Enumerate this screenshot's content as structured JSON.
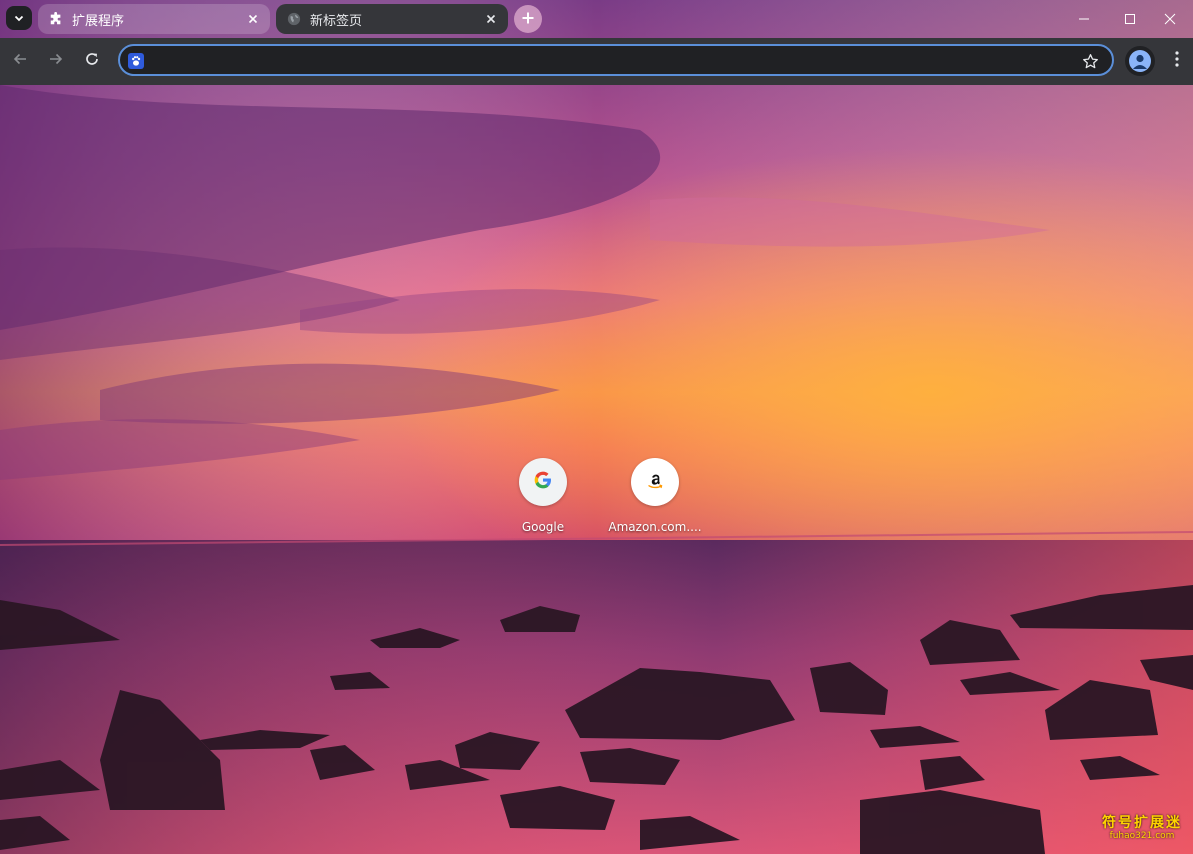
{
  "tabs": [
    {
      "label": "扩展程序",
      "favicon": "puzzle-icon",
      "active": false
    },
    {
      "label": "新标签页",
      "favicon": "globe-icon",
      "active": true
    }
  ],
  "omnibox": {
    "value": "",
    "placeholder": "",
    "search_engine_icon": "baidu-paw-icon"
  },
  "shortcuts": [
    {
      "title": "Google",
      "icon": "google-g-icon"
    },
    {
      "title": "Amazon.com....",
      "icon": "amazon-a-icon"
    }
  ],
  "watermark": {
    "line1": "符号扩展迷",
    "line2": "fuhao321.com"
  },
  "colors": {
    "tab_active": "#35363a",
    "toolbar": "#35363a",
    "omnibox_border": "#5b8fd9",
    "avatar": "#8ab4f8"
  }
}
